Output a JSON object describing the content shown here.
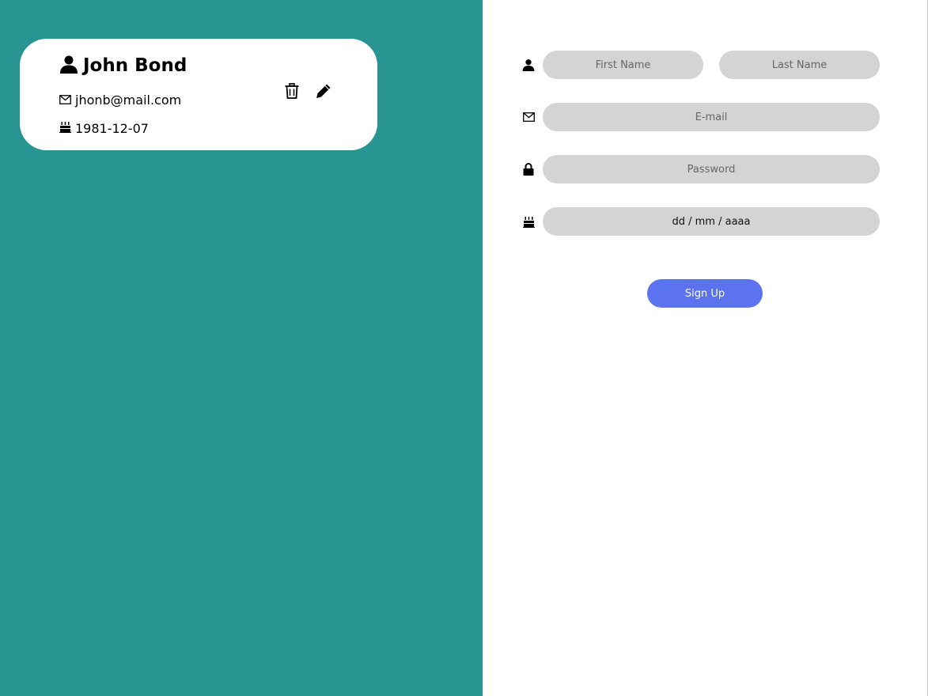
{
  "colors": {
    "left_panel": "#289593",
    "card_bg": "#ffffff",
    "input_bg": "#d4d4d4",
    "button_bg": "#5b73ee"
  },
  "user_card": {
    "name": "John Bond",
    "email": "jhonb@mail.com",
    "birthdate": "1981-12-07",
    "icons": {
      "name": "user-icon",
      "email": "envelope-icon",
      "birthdate": "birthday-cake-icon",
      "delete": "trash-icon",
      "edit": "pencil-icon"
    }
  },
  "form": {
    "first_name_placeholder": "First Name",
    "last_name_placeholder": "Last Name",
    "email_placeholder": "E-mail",
    "password_placeholder": "Password",
    "date_placeholder": "dd / mm / aaaa",
    "submit_label": "Sign Up",
    "icons": {
      "name": "user-icon",
      "email": "envelope-icon",
      "password": "lock-icon",
      "date": "birthday-cake-icon"
    }
  }
}
